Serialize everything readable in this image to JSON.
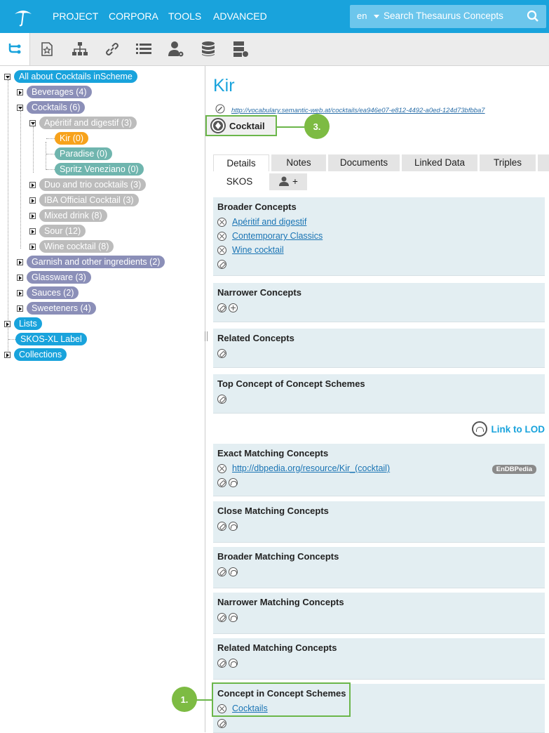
{
  "topbar": {
    "nav": [
      "PROJECT",
      "CORPORA",
      "TOOLS",
      "ADVANCED"
    ],
    "search": {
      "lang": "en",
      "placeholder": "Search Thesaurus Concepts"
    }
  },
  "toolbar": {
    "icons": [
      "hierarchy-icon",
      "concept-star-icon",
      "org-chart-icon",
      "link-icon",
      "list-icon",
      "user-settings-icon",
      "database-icon",
      "server-icon"
    ]
  },
  "tree": {
    "root": "All about Cocktails inScheme",
    "beverages": "Beverages (4)",
    "cocktails": "Cocktails (6)",
    "aperitif": "Apéritif and digestif (3)",
    "kir": "Kir (0)",
    "paradise": "Paradise (0)",
    "spritz": "Spritz Veneziano (0)",
    "duo": "Duo and trio cocktails (3)",
    "iba": "IBA Official Cocktail (3)",
    "mixed": "Mixed drink (8)",
    "sour": "Sour (12)",
    "wine": "Wine cocktail (8)",
    "garnish": "Garnish and other ingredients (2)",
    "glassware": "Glassware (3)",
    "sauces": "Sauces (2)",
    "sweeteners": "Sweeteners (4)",
    "lists": "Lists",
    "skosxl": "SKOS-XL Label",
    "collections": "Collections"
  },
  "detail": {
    "title": "Kir",
    "uri": "http://vocabulary.semantic-web.at/cocktails/ea946e07-e812-4492-a0ed-124d73bfbba7",
    "type": "Cocktail",
    "tabs": [
      "Details",
      "Notes",
      "Documents",
      "Linked Data",
      "Triples"
    ],
    "subtabs": {
      "skos": "SKOS",
      "add": "+"
    },
    "broader": {
      "title": "Broader Concepts",
      "items": [
        "Apéritif and digestif",
        "Contemporary Classics",
        "Wine cocktail"
      ]
    },
    "narrower": {
      "title": "Narrower Concepts"
    },
    "related": {
      "title": "Related Concepts"
    },
    "topconcept": {
      "title": "Top Concept of Concept Schemes"
    },
    "lod": "Link to LOD",
    "exact": {
      "title": "Exact Matching Concepts",
      "item": "http://dbpedia.org/resource/Kir_(cocktail)",
      "badge": "EnDBPedia"
    },
    "close": {
      "title": "Close Matching Concepts"
    },
    "broadermatch": {
      "title": "Broader Matching Concepts"
    },
    "narrowermatch": {
      "title": "Narrower Matching Concepts"
    },
    "relatedmatch": {
      "title": "Related Matching Concepts"
    },
    "inscheme": {
      "title": "Concept in Concept Schemes",
      "item": "Cocktails"
    }
  },
  "callouts": {
    "one": "1.",
    "three": "3."
  },
  "colors": {
    "brand": "#19a3dc",
    "highlight": "#6bb64a",
    "selected": "#f7a21b",
    "section": "#e3eef2"
  }
}
